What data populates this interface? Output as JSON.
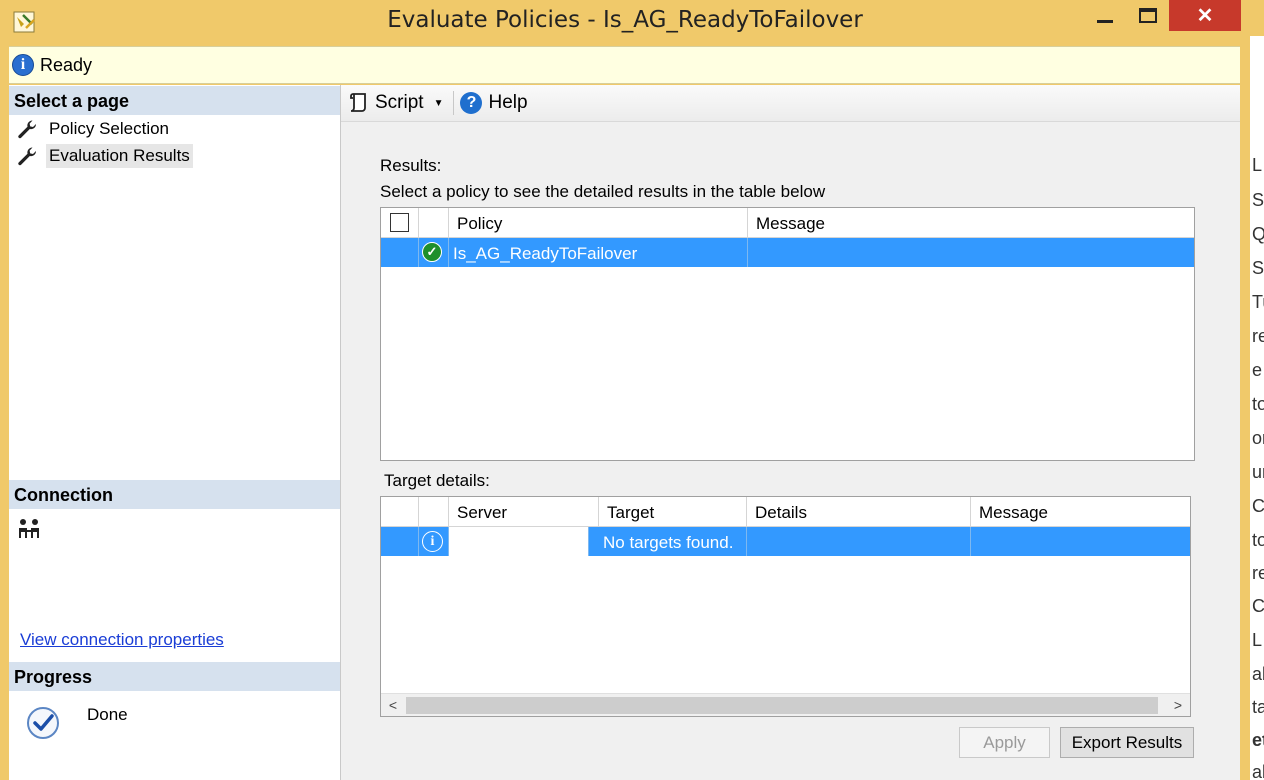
{
  "window": {
    "title": "Evaluate Policies - Is_AG_ReadyToFailover"
  },
  "status": {
    "text": "Ready"
  },
  "left_pane": {
    "select_page_header": "Select a page",
    "pages": [
      {
        "label": "Policy Selection"
      },
      {
        "label": "Evaluation Results",
        "selected": true
      }
    ],
    "connection_header": "Connection",
    "view_connection_link": "View connection properties",
    "progress_header": "Progress",
    "progress_text": "Done"
  },
  "toolbar": {
    "script_label": "Script",
    "help_label": "Help"
  },
  "results": {
    "label": "Results:",
    "hint": "Select a policy to see the detailed results in the table below",
    "columns": [
      "Policy",
      "Message"
    ],
    "rows": [
      {
        "policy": "Is_AG_ReadyToFailover",
        "message": "",
        "status_icon": "success-check-icon"
      }
    ]
  },
  "target_details": {
    "label": "Target details:",
    "columns": [
      "Server",
      "Target",
      "Details",
      "Message"
    ],
    "rows": [
      {
        "server": "",
        "target": "No targets found.",
        "details": "",
        "message": "",
        "status_icon": "info-icon"
      }
    ]
  },
  "buttons": {
    "apply": "Apply",
    "export": "Export Results"
  },
  "background_window": {
    "visible_chars": [
      "L S",
      "SC",
      "QL",
      "SC",
      "Tu",
      "re",
      "e T",
      "to",
      "or",
      "ur",
      "C",
      "to",
      "re",
      "C",
      "L I",
      "ab",
      "ta",
      "et",
      "al"
    ]
  },
  "colors": {
    "title_bar": "#f0c96a",
    "selection": "#3399ff",
    "close_button": "#c7392b",
    "section_header": "#d6e1ee"
  }
}
